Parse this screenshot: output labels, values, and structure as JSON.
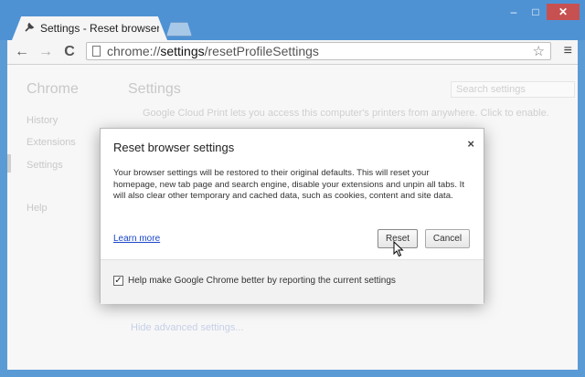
{
  "window": {
    "controls": {
      "minimize": "–",
      "maximize": "□",
      "close": "✕"
    }
  },
  "tab": {
    "title": "Settings - Reset browser s",
    "icon": "wrench-icon"
  },
  "toolbar": {
    "url_prefix": "chrome://",
    "url_path_bold": "settings",
    "url_suffix": "/resetProfileSettings",
    "back": "←",
    "forward": "→",
    "reload": "C",
    "star": "☆",
    "menu": "≡"
  },
  "sidebar": {
    "brand": "Chrome",
    "items": [
      {
        "label": "History"
      },
      {
        "label": "Extensions"
      },
      {
        "label": "Settings"
      },
      {
        "label": "Help"
      }
    ]
  },
  "main": {
    "title": "Settings",
    "search_placeholder": "Search settings",
    "cloud_print_text": "Google Cloud Print lets you access this computer's printers from anywhere. Click to enable.",
    "hide_advanced": "Hide advanced settings..."
  },
  "dialog": {
    "title": "Reset browser settings",
    "close": "×",
    "body": "Your browser settings will be restored to their original defaults. This will reset your homepage, new tab page and search engine, disable your extensions and unpin all tabs. It will also clear other temporary and cached data, such as cookies, content and site data.",
    "learn_more": "Learn more",
    "reset_button": "Reset",
    "cancel_button": "Cancel",
    "checkbox_checked": true,
    "checkbox_mark": "✓",
    "checkbox_label": "Help make Google Chrome better by reporting the current settings"
  }
}
